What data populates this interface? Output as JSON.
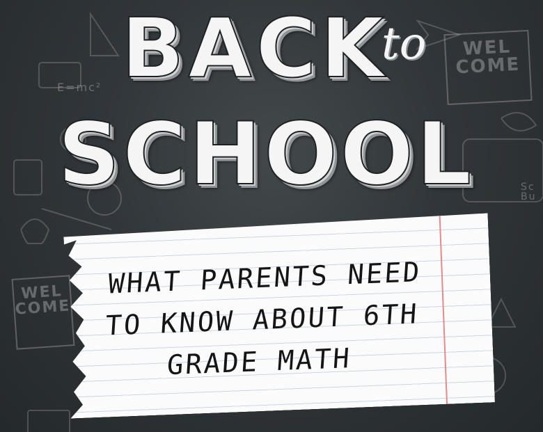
{
  "title": {
    "word1": "BACK",
    "word2": "to",
    "word3": "SCHOOL"
  },
  "note": {
    "line1": "WHAT PARENTS NEED",
    "line2": "TO KNOW ABOUT 6TH",
    "line3": "GRADE MATH"
  },
  "doodles": {
    "welcome_sign_1": "WEL\nCOME",
    "welcome_sign_2": "WEL\nCOME",
    "formula": "E=mc²",
    "school_sign": "Sc\nBu"
  },
  "colors": {
    "chalkboard": "#2b2f31",
    "chalk": "#f5f5f5",
    "paper": "#fbfbfb",
    "paper_rule": "#c9d7ea",
    "paper_margin": "#e58a8a"
  }
}
